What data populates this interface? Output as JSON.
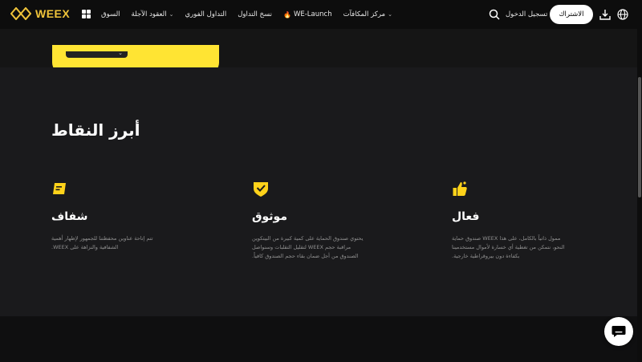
{
  "nav": {
    "logo_text": "WEEX",
    "menu": [
      {
        "label": "السوق",
        "chevron": false
      },
      {
        "label": "العقود الآجلة",
        "chevron": true
      },
      {
        "label": "التداول الفوري",
        "chevron": false
      },
      {
        "label": "نسخ التداول",
        "chevron": false
      },
      {
        "label": "WE-Launch",
        "chevron": false,
        "flame": true
      },
      {
        "label": "مركز المكافآت",
        "chevron": true
      }
    ],
    "login": "تسجيل الدخول",
    "signup": "الاشتراك"
  },
  "hero": {
    "dropdown_chevron": "⌄"
  },
  "highlights": {
    "heading": "أبرز النقاط",
    "features": [
      {
        "title": "شفاف",
        "icon": "document-icon",
        "desc_lines": [
          "تتم إتاحة عناوين محفظتنا للجمهور لإظهار أهمية",
          "الشفافية والنزاهة على WEEX."
        ]
      },
      {
        "title": "موثوق",
        "icon": "shield-check-icon",
        "desc_lines": [
          "يحتوي صندوق الحماية على كمية كبيرة من البيتكوين",
          "مراقبة حجم WEEX لتقليل التقلبات وسنواصل",
          "الصندوق من أجل ضمان بقاء حجم الصندوق كافياً."
        ]
      },
      {
        "title": "فعال",
        "icon": "thumbs-up-icon",
        "desc_lines": [
          "ممول ذاتياً بالكامل، على هذا WEEX صندوق حماية",
          "النحو، نتمكن من تغطية أي خسارة لأموال مستخدمينا",
          "بكفاءة دون بيروقراطية خارجية."
        ]
      }
    ]
  },
  "colors": {
    "accent": "#f0c43a",
    "hero_yellow": "#ffe433",
    "background": "#1a1a1c"
  }
}
